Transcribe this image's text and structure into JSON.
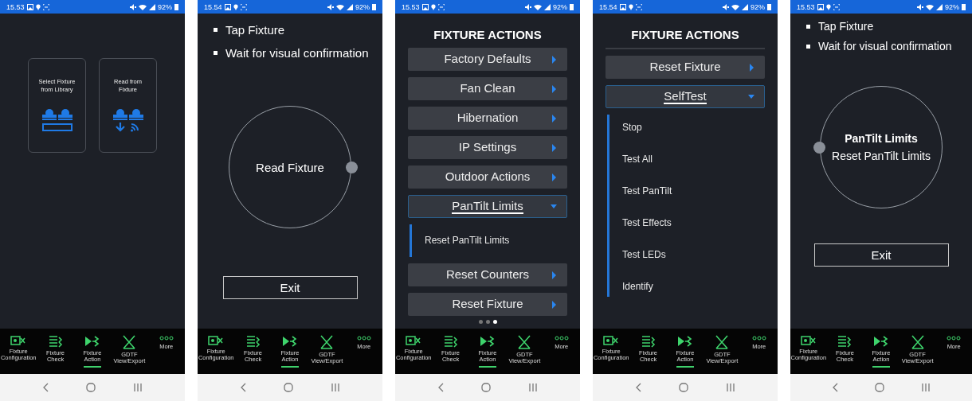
{
  "phones": [
    {
      "status_bar": {
        "time": "15.53",
        "battery": "92%"
      },
      "screen": {
        "kind": "cards",
        "cards": [
          {
            "label": "Select Fixture from Library",
            "kind": "library"
          },
          {
            "label": "Read from Fixture",
            "kind": "read"
          }
        ]
      },
      "nav": [
        {
          "label": "Fixture Configuration",
          "kind": "config",
          "selected": false
        },
        {
          "label": "Fixture Check",
          "kind": "check",
          "selected": false
        },
        {
          "label": "Fixture Action",
          "kind": "action",
          "selected": true
        },
        {
          "label": "GDTF View/Export",
          "kind": "gdtf",
          "selected": false
        },
        {
          "label": "More",
          "kind": "more",
          "selected": false
        }
      ]
    },
    {
      "status_bar": {
        "time": "15.54",
        "battery": "92%"
      },
      "screen": {
        "kind": "progress",
        "bullets": [
          "Tap Fixture",
          "Wait for visual confirmation"
        ],
        "circle": {
          "title": "Read Fixture"
        },
        "button": "Exit"
      },
      "nav": [
        {
          "label": "Fixture Configuration",
          "kind": "config",
          "selected": false
        },
        {
          "label": "Fixture Check",
          "kind": "check",
          "selected": false
        },
        {
          "label": "Fixture Action",
          "kind": "action",
          "selected": true
        },
        {
          "label": "GDTF View/Export",
          "kind": "gdtf",
          "selected": false
        },
        {
          "label": "More",
          "kind": "more",
          "selected": false
        }
      ]
    },
    {
      "status_bar": {
        "time": "15.53",
        "battery": "92%"
      },
      "screen": {
        "kind": "actions",
        "title": "FIXTURE ACTIONS",
        "items": [
          {
            "label": "Factory Defaults",
            "expanded": false
          },
          {
            "label": "Fan Clean",
            "expanded": false
          },
          {
            "label": "Hibernation",
            "expanded": false
          },
          {
            "label": "IP Settings",
            "expanded": false
          },
          {
            "label": "Outdoor Actions",
            "expanded": false
          },
          {
            "label": "PanTilt Limits",
            "expanded": true,
            "children": [
              "Reset PanTilt Limits"
            ]
          },
          {
            "label": "Reset Counters",
            "expanded": false
          },
          {
            "label": "Reset Fixture",
            "expanded": false
          }
        ],
        "pages": [
          {
            "selected": false
          },
          {
            "selected": false
          },
          {
            "selected": true
          }
        ]
      },
      "nav": [
        {
          "label": "Fixture Configuration",
          "kind": "config",
          "selected": false
        },
        {
          "label": "Fixture Check",
          "kind": "check",
          "selected": false
        },
        {
          "label": "Fixture Action",
          "kind": "action",
          "selected": true
        },
        {
          "label": "GDTF View/Export",
          "kind": "gdtf",
          "selected": false
        },
        {
          "label": "More",
          "kind": "more",
          "selected": false
        }
      ]
    },
    {
      "status_bar": {
        "time": "15.54",
        "battery": "92%"
      },
      "screen": {
        "kind": "actions",
        "title": "FIXTURE ACTIONS",
        "scrolled": true,
        "items": [
          {
            "label": "Reset Fixture",
            "expanded": false
          },
          {
            "label": "SelfTest",
            "expanded": true,
            "children": [
              "Stop",
              "Test All",
              "Test PanTilt",
              "Test Effects",
              "Test LEDs",
              "Identify"
            ]
          }
        ]
      },
      "nav": [
        {
          "label": "Fixture Configuration",
          "kind": "config",
          "selected": false
        },
        {
          "label": "Fixture Check",
          "kind": "check",
          "selected": false
        },
        {
          "label": "Fixture Action",
          "kind": "action",
          "selected": true
        },
        {
          "label": "GDTF View/Export",
          "kind": "gdtf",
          "selected": false
        },
        {
          "label": "More",
          "kind": "more",
          "selected": false
        }
      ]
    },
    {
      "status_bar": {
        "time": "15.53",
        "battery": "92%"
      },
      "screen": {
        "kind": "progress",
        "bullets": [
          "Tap Fixture",
          "Wait for visual confirmation"
        ],
        "circle": {
          "title": "PanTilt Limits",
          "subtitle": "Reset PanTilt Limits"
        },
        "button": "Exit"
      },
      "nav": [
        {
          "label": "Fixture Configuration",
          "kind": "config",
          "selected": false
        },
        {
          "label": "Fixture Check",
          "kind": "check",
          "selected": false
        },
        {
          "label": "Fixture Action",
          "kind": "action",
          "selected": true
        },
        {
          "label": "GDTF View/Export",
          "kind": "gdtf",
          "selected": false
        },
        {
          "label": "More",
          "kind": "more",
          "selected": false
        }
      ]
    }
  ]
}
